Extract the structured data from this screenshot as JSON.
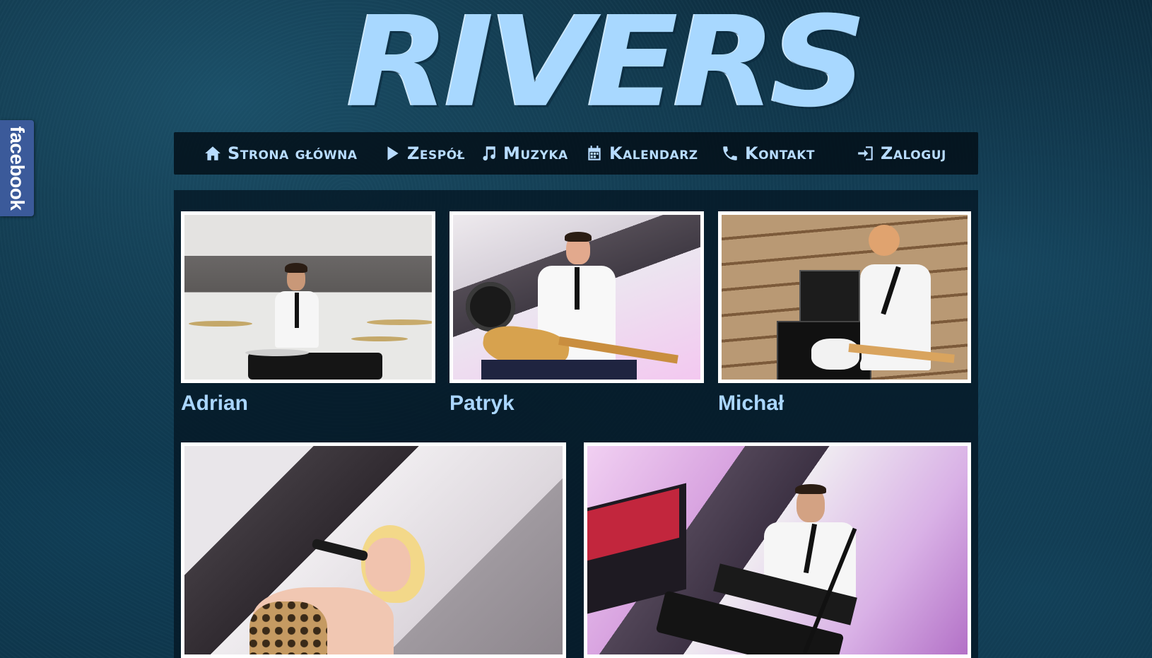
{
  "facebook_tab": {
    "label": "facebook"
  },
  "logo": {
    "text": "RIVERS"
  },
  "nav": {
    "items": [
      {
        "label": "Strona główna",
        "icon": "home-icon"
      },
      {
        "label": "Zespół",
        "icon": "play-icon"
      },
      {
        "label": "Muzyka",
        "icon": "music-note-icon"
      },
      {
        "label": "Kalendarz",
        "icon": "calendar-icon"
      },
      {
        "label": "Kontakt",
        "icon": "phone-icon"
      },
      {
        "label": "Zaloguj",
        "icon": "login-icon"
      }
    ]
  },
  "members": [
    {
      "name": "Adrian"
    },
    {
      "name": "Patryk"
    },
    {
      "name": "Michał"
    }
  ],
  "photos_row2": [
    {
      "alt": "vocalist"
    },
    {
      "alt": "keyboard player"
    }
  ],
  "colors": {
    "accent": "#aad6ff",
    "facebook": "#3b5a9a",
    "background": "#0c2d3f"
  }
}
